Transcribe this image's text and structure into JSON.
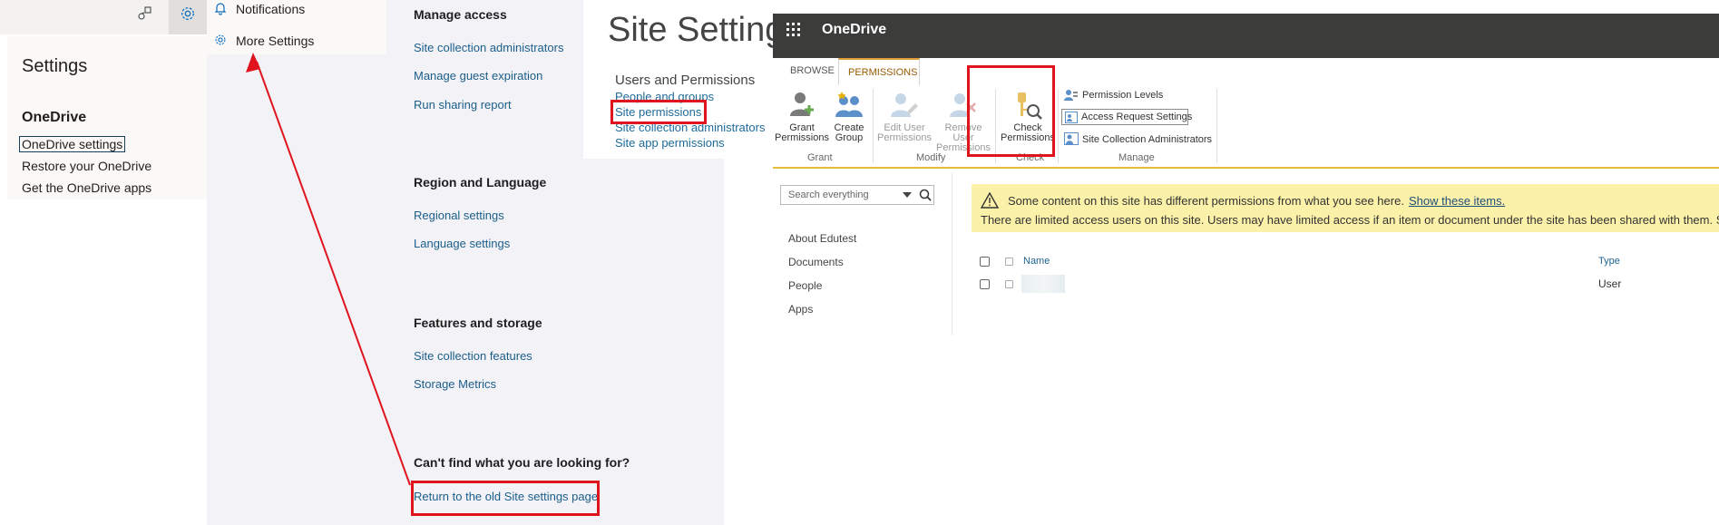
{
  "settings_flyout": {
    "title": "Settings",
    "section": "OneDrive",
    "links": [
      "OneDrive settings",
      "Restore your OneDrive",
      "Get the OneDrive apps"
    ],
    "menu": {
      "notifications": "Notifications",
      "more_settings": "More Settings"
    }
  },
  "modern_settings": {
    "manage_access": {
      "heading": "Manage access",
      "links": [
        "Site collection administrators",
        "Manage guest expiration",
        "Run sharing report"
      ]
    },
    "region": {
      "heading": "Region and Language",
      "links": [
        "Regional settings",
        "Language settings"
      ]
    },
    "features": {
      "heading": "Features and storage",
      "links": [
        "Site collection features",
        "Storage Metrics"
      ]
    },
    "help": {
      "heading": "Can't find what you are looking for?",
      "link": "Return to the old Site settings page"
    }
  },
  "classic_settings": {
    "title": "Site Settings",
    "group": "Users and Permissions",
    "links": [
      "People and groups",
      "Site permissions",
      "Site collection administrators",
      "Site app permissions"
    ]
  },
  "onedrive": {
    "app_title": "OneDrive",
    "tabs": [
      "BROWSE",
      "PERMISSIONS"
    ],
    "ribbon": {
      "grant": {
        "label": "Grant",
        "buttons": [
          "Grant Permissions",
          "Create Group"
        ]
      },
      "modify": {
        "label": "Modify",
        "buttons": [
          "Edit User Permissions",
          "Remove User Permissions"
        ]
      },
      "check": {
        "label": "Check",
        "buttons": [
          "Check Permissions"
        ]
      },
      "manage": {
        "label": "Manage",
        "buttons": [
          "Permission Levels",
          "Access Request Settings",
          "Site Collection Administrators"
        ]
      }
    },
    "search_placeholder": "Search everything",
    "nav": [
      "About Edutest",
      "Documents",
      "People",
      "Apps"
    ],
    "warning": {
      "line1": "Some content on this site has different permissions from what you see here.",
      "line1_link": "Show these items.",
      "line2": "There are limited access users on this site. Users may have limited access if an item or document under the site has been shared with them. Sh"
    },
    "grid": {
      "columns": [
        "Name",
        "Type"
      ],
      "rows": [
        {
          "name": "",
          "type": "User"
        }
      ]
    }
  },
  "colors": {
    "annotation_red": "#e0141d",
    "suite_bar": "#3c3c3b",
    "active_tab": "#e09b35",
    "link_blue": "#1b5e8a",
    "warning_bg": "#fbf1a9"
  }
}
